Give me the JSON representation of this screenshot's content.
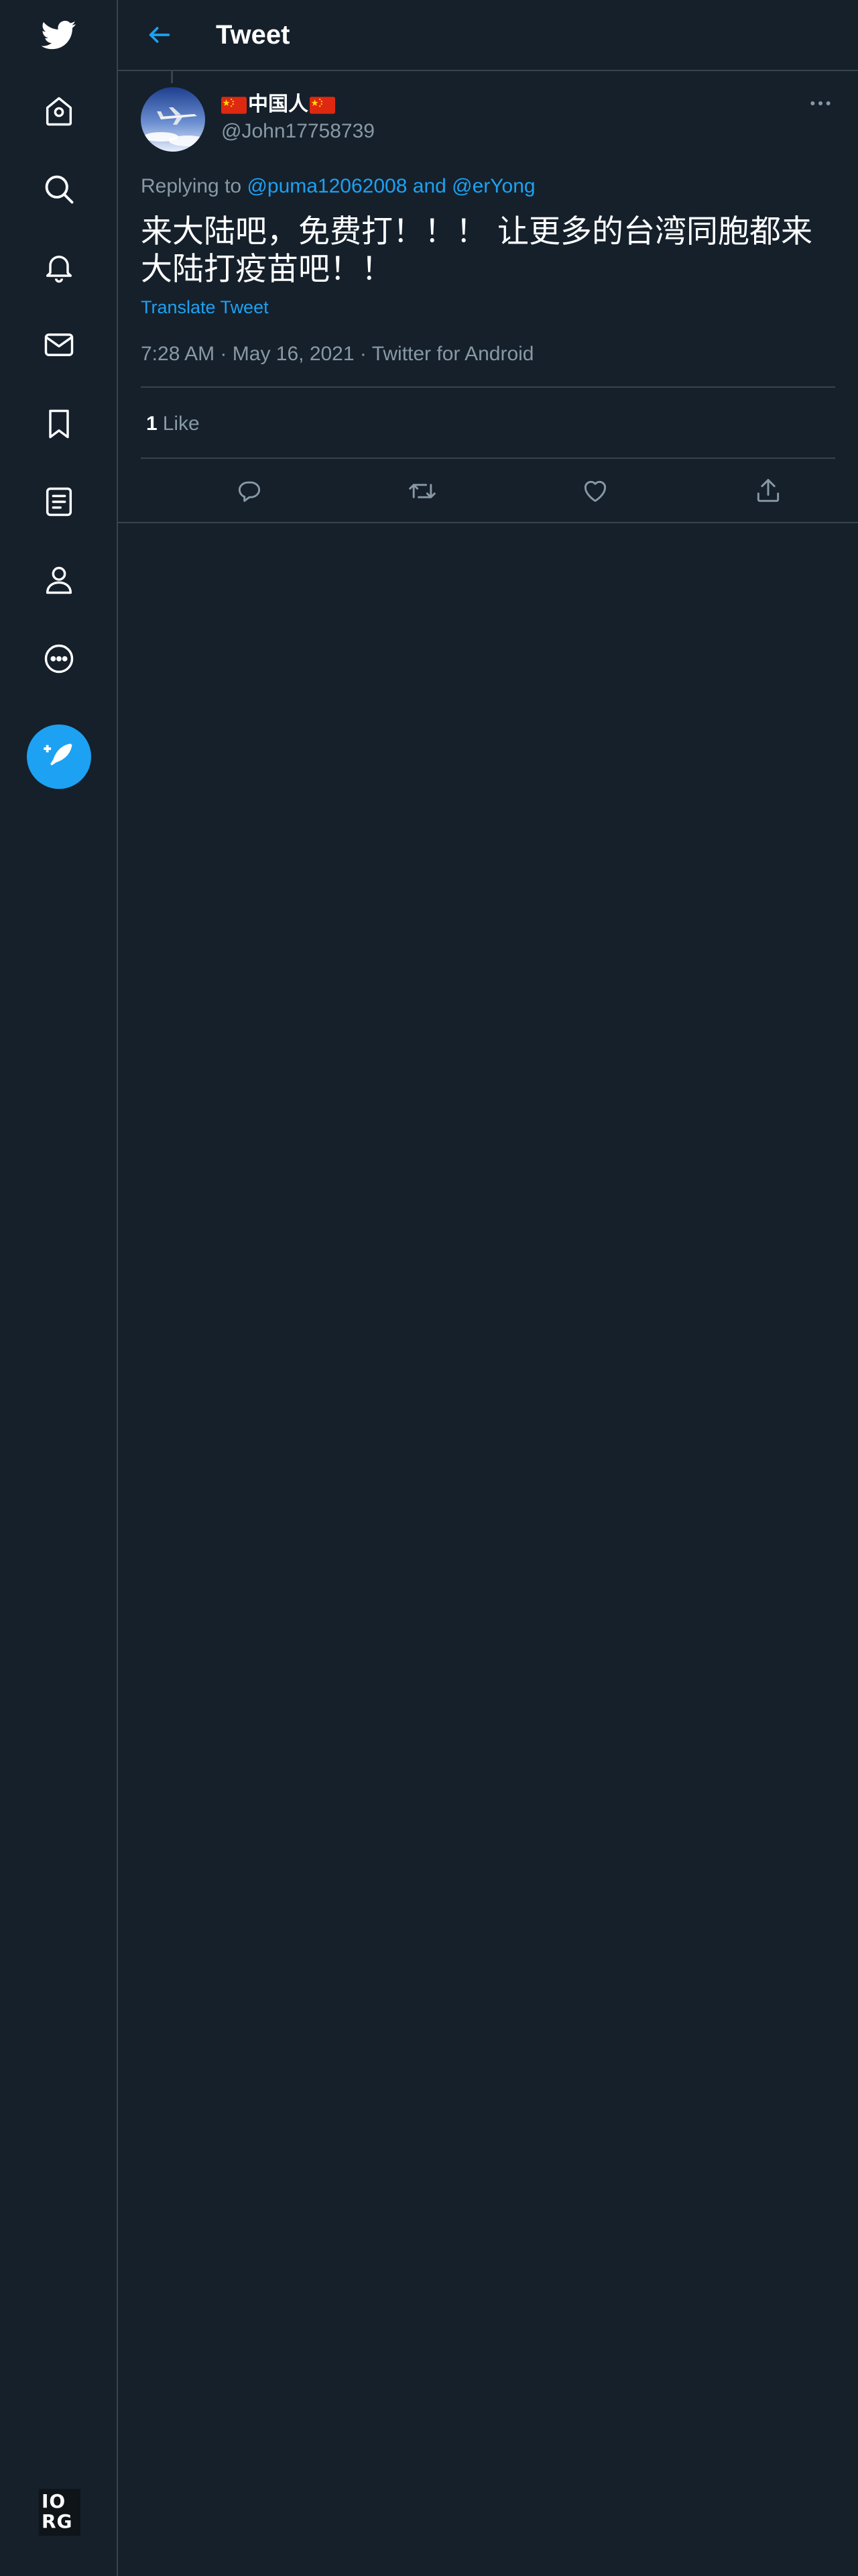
{
  "colors": {
    "background": "#15202b",
    "accent": "#1da1f2",
    "secondary_text": "#8899a6",
    "border": "#38444d"
  },
  "sidebar": {
    "items": [
      {
        "icon": "twitter-logo-icon"
      },
      {
        "icon": "home-icon"
      },
      {
        "icon": "search-icon"
      },
      {
        "icon": "notifications-bell-icon"
      },
      {
        "icon": "messages-envelope-icon"
      },
      {
        "icon": "bookmark-icon"
      },
      {
        "icon": "lists-icon"
      },
      {
        "icon": "profile-icon"
      },
      {
        "icon": "more-circle-icon"
      }
    ],
    "compose_icon": "compose-feather-icon",
    "footer_logo": {
      "line1": "IO",
      "line2": "RG"
    }
  },
  "header": {
    "title": "Tweet",
    "back_icon": "back-arrow-icon"
  },
  "tweet": {
    "display_name": "中国人",
    "display_name_flags": "cn-flag",
    "handle": "@John17758739",
    "replying_to_prefix": "Replying to",
    "replying_to_user1": "@puma12062008",
    "replying_to_and": "and",
    "replying_to_user2": "@erYong",
    "text": "来大陆吧，免费打！！！ 让更多的台湾同胞都来大陆打疫苗吧！！",
    "translate_label": "Translate Tweet",
    "time": "7:28 AM",
    "date": "May 16, 2021",
    "source": "Twitter for Android",
    "separator": "·",
    "like_count": "1",
    "like_label": "Like"
  },
  "actions": [
    {
      "name": "reply",
      "icon": "reply-icon"
    },
    {
      "name": "retweet",
      "icon": "retweet-icon"
    },
    {
      "name": "like",
      "icon": "heart-icon"
    },
    {
      "name": "share",
      "icon": "share-icon"
    }
  ]
}
